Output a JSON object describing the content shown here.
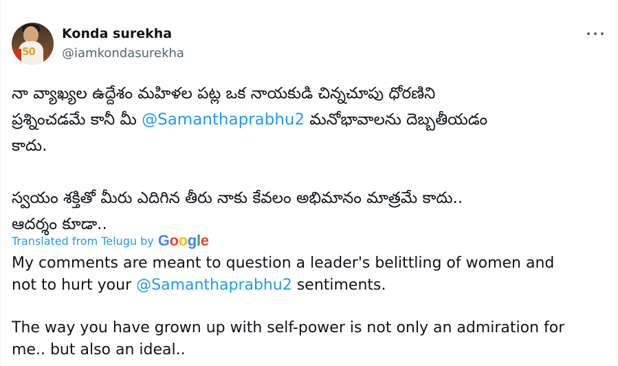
{
  "author": {
    "name": "Konda surekha",
    "handle": "@iamkondasurekha",
    "avatar_badge": "50"
  },
  "more_icon": "more-horizontal-icon",
  "telugu": {
    "line1": "నా వ్యాఖ్యల ఉద్దేశం మహిళల పట్ల ఒక నాయకుడి చిన్నచూపు ధోరణిని",
    "line2_before": "ప్రశ్నించడమే కానీ మీ ",
    "line2_mention": "@Samanthaprabhu2",
    "line2_after": " మనోభావాలను దెబ్బతీయడం",
    "line3": "కాదు.",
    "line4": "స్వయం శక్తితో మీరు ఎదిగిన తీరు నాకు కేవలం అభిమానం మాత్రమే కాదు..",
    "line5": "ఆదర్శం కూడా.."
  },
  "translation": {
    "label": "Translated from Telugu by",
    "provider": "Google"
  },
  "english": {
    "line1": "My comments are meant to question a leader's belittling of women and",
    "line2_before": "not to hurt your ",
    "line2_mention": "@Samanthaprabhu2",
    "line2_after": " sentiments.",
    "line3": "The way you have grown up with self-power is not only an admiration for",
    "line4": "me.. but also an ideal.."
  },
  "colors": {
    "link": "#1d9bf0",
    "secondary": "#536471",
    "text": "#0f1419"
  }
}
